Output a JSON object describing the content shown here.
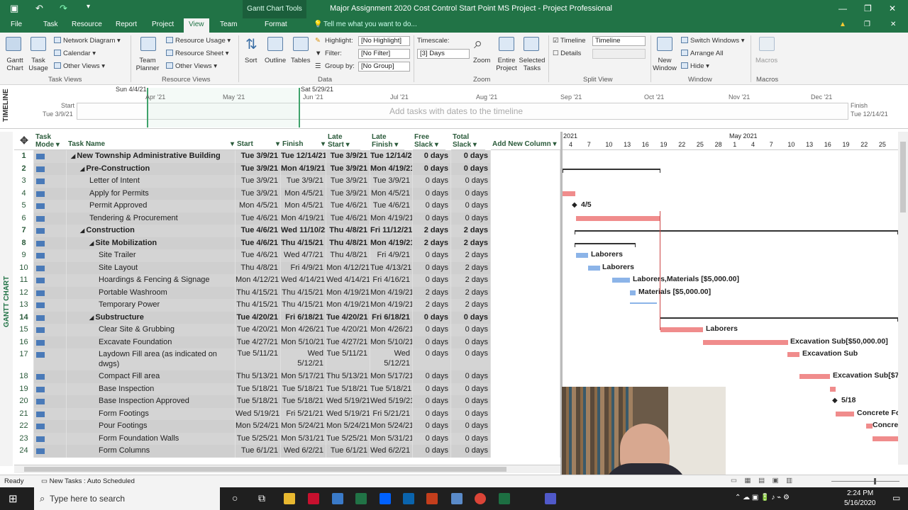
{
  "window": {
    "title": "Major Assignment  2020 Cost Control Start Point MS Project  -  Project Professional",
    "context_tab": "Gantt Chart Tools",
    "tell_me": "Tell me what you want to do..."
  },
  "tabs": [
    "File",
    "Task",
    "Resource",
    "Report",
    "Project",
    "View",
    "Team",
    "Format"
  ],
  "ribbon": {
    "gantt_chart": "Gantt Chart",
    "task_usage": "Task Usage",
    "network_diagram": "Network Diagram",
    "calendar": "Calendar",
    "other_views": "Other Views",
    "team_planner": "Team Planner",
    "resource_usage": "Resource Usage",
    "resource_sheet": "Resource Sheet",
    "other_views2": "Other Views",
    "sort": "Sort",
    "outline": "Outline",
    "tables": "Tables",
    "highlight_label": "Highlight:",
    "highlight_value": "[No Highlight]",
    "filter_label": "Filter:",
    "filter_value": "[No Filter]",
    "group_label": "Group by:",
    "group_value": "[No Group]",
    "timescale_label": "Timescale:",
    "timescale_value": "[3] Days",
    "zoom": "Zoom",
    "entire_project": "Entire Project",
    "selected_tasks": "Selected Tasks",
    "timeline_chk": "Timeline",
    "timeline_value": "Timeline",
    "details_chk": "Details",
    "new_window": "New Window",
    "switch_windows": "Switch Windows",
    "arrange_all": "Arrange All",
    "hide": "Hide",
    "macros": "Macros",
    "groups": [
      "Task Views",
      "Resource Views",
      "Data",
      "Zoom",
      "Split View",
      "Window",
      "Macros"
    ]
  },
  "timeline": {
    "side_label": "TIMELINE",
    "start_label": "Start",
    "start_date": "Tue 3/9/21",
    "finish_label": "Finish",
    "finish_date": "Tue 12/14/21",
    "marker_left": "Sun 4/4/21",
    "marker_right": "Sat 5/29/21",
    "months": [
      "Apr '21",
      "May '21",
      "Jun '21",
      "Jul '21",
      "Aug '21",
      "Sep '21",
      "Oct '21",
      "Nov '21",
      "Dec '21"
    ],
    "placeholder": "Add tasks with dates to the timeline"
  },
  "gantt_side_label": "GANTT CHART",
  "columns": [
    "Task Mode",
    "Task Name",
    "Start",
    "Finish",
    "Late Start",
    "Late Finish",
    "Free Slack",
    "Total Slack",
    "Add New Column"
  ],
  "rows": [
    {
      "id": "1",
      "name": "New Township Administrative Building",
      "start": "Tue 3/9/21",
      "finish": "Tue 12/14/21",
      "lstart": "Tue 3/9/21",
      "lfinish": "Tue 12/14/21",
      "free": "0 days",
      "total": "0 days",
      "level": 0,
      "summary": true
    },
    {
      "id": "2",
      "name": "Pre-Construction",
      "start": "Tue 3/9/21",
      "finish": "Mon 4/19/21",
      "lstart": "Tue 3/9/21",
      "lfinish": "Mon 4/19/21",
      "free": "0 days",
      "total": "0 days",
      "level": 1,
      "summary": true
    },
    {
      "id": "3",
      "name": "Letter of Intent",
      "start": "Tue 3/9/21",
      "finish": "Tue 3/9/21",
      "lstart": "Tue 3/9/21",
      "lfinish": "Tue 3/9/21",
      "free": "0 days",
      "total": "0 days",
      "level": 2,
      "summary": false
    },
    {
      "id": "4",
      "name": "Apply for Permits",
      "start": "Tue 3/9/21",
      "finish": "Mon 4/5/21",
      "lstart": "Tue 3/9/21",
      "lfinish": "Mon 4/5/21",
      "free": "0 days",
      "total": "0 days",
      "level": 2,
      "summary": false
    },
    {
      "id": "5",
      "name": "Permit Approved",
      "start": "Mon 4/5/21",
      "finish": "Mon 4/5/21",
      "lstart": "Tue 4/6/21",
      "lfinish": "Tue 4/6/21",
      "free": "0 days",
      "total": "0 days",
      "level": 2,
      "summary": false
    },
    {
      "id": "6",
      "name": "Tendering & Procurement",
      "start": "Tue 4/6/21",
      "finish": "Mon 4/19/21",
      "lstart": "Tue 4/6/21",
      "lfinish": "Mon 4/19/21",
      "free": "0 days",
      "total": "0 days",
      "level": 2,
      "summary": false
    },
    {
      "id": "7",
      "name": "Construction",
      "start": "Tue 4/6/21",
      "finish": "Wed 11/10/21",
      "lstart": "Thu 4/8/21",
      "lfinish": "Fri 11/12/21",
      "free": "2 days",
      "total": "2 days",
      "level": 1,
      "summary": true
    },
    {
      "id": "8",
      "name": "Site Mobilization",
      "start": "Tue 4/6/21",
      "finish": "Thu 4/15/21",
      "lstart": "Thu 4/8/21",
      "lfinish": "Mon 4/19/21",
      "free": "2 days",
      "total": "2 days",
      "level": 2,
      "summary": true
    },
    {
      "id": "9",
      "name": "Site Trailer",
      "start": "Tue 4/6/21",
      "finish": "Wed 4/7/21",
      "lstart": "Thu 4/8/21",
      "lfinish": "Fri 4/9/21",
      "free": "0 days",
      "total": "2 days",
      "level": 3,
      "summary": false
    },
    {
      "id": "10",
      "name": "Site Layout",
      "start": "Thu 4/8/21",
      "finish": "Fri 4/9/21",
      "lstart": "Mon 4/12/21",
      "lfinish": "Tue 4/13/21",
      "free": "0 days",
      "total": "2 days",
      "level": 3,
      "summary": false
    },
    {
      "id": "11",
      "name": "Hoardings & Fencing & Signage",
      "start": "Mon 4/12/21",
      "finish": "Wed 4/14/21",
      "lstart": "Wed 4/14/21",
      "lfinish": "Fri 4/16/21",
      "free": "0 days",
      "total": "2 days",
      "level": 3,
      "summary": false
    },
    {
      "id": "12",
      "name": "Portable Washroom",
      "start": "Thu 4/15/21",
      "finish": "Thu 4/15/21",
      "lstart": "Mon 4/19/21",
      "lfinish": "Mon 4/19/21",
      "free": "2 days",
      "total": "2 days",
      "level": 3,
      "summary": false
    },
    {
      "id": "13",
      "name": "Temporary Power",
      "start": "Thu 4/15/21",
      "finish": "Thu 4/15/21",
      "lstart": "Mon 4/19/21",
      "lfinish": "Mon 4/19/21",
      "free": "2 days",
      "total": "2 days",
      "level": 3,
      "summary": false
    },
    {
      "id": "14",
      "name": "Substructure",
      "start": "Tue 4/20/21",
      "finish": "Fri 6/18/21",
      "lstart": "Tue 4/20/21",
      "lfinish": "Fri 6/18/21",
      "free": "0 days",
      "total": "0 days",
      "level": 2,
      "summary": true
    },
    {
      "id": "15",
      "name": "Clear Site & Grubbing",
      "start": "Tue 4/20/21",
      "finish": "Mon 4/26/21",
      "lstart": "Tue 4/20/21",
      "lfinish": "Mon 4/26/21",
      "free": "0 days",
      "total": "0 days",
      "level": 3,
      "summary": false
    },
    {
      "id": "16",
      "name": "Excavate Foundation",
      "start": "Tue 4/27/21",
      "finish": "Mon 5/10/21",
      "lstart": "Tue 4/27/21",
      "lfinish": "Mon 5/10/21",
      "free": "0 days",
      "total": "0 days",
      "level": 3,
      "summary": false
    },
    {
      "id": "17",
      "name": "Laydown Fill area (as indicated on dwgs)",
      "start": "Tue 5/11/21",
      "finish": "Wed 5/12/21",
      "lstart": "Tue 5/11/21",
      "lfinish": "Wed 5/12/21",
      "free": "0 days",
      "total": "0 days",
      "level": 3,
      "summary": false,
      "tall": true
    },
    {
      "id": "18",
      "name": "Compact Fill area",
      "start": "Thu 5/13/21",
      "finish": "Mon 5/17/21",
      "lstart": "Thu 5/13/21",
      "lfinish": "Mon 5/17/21",
      "free": "0 days",
      "total": "0 days",
      "level": 3,
      "summary": false
    },
    {
      "id": "19",
      "name": "Base Inspection",
      "start": "Tue 5/18/21",
      "finish": "Tue 5/18/21",
      "lstart": "Tue 5/18/21",
      "lfinish": "Tue 5/18/21",
      "free": "0 days",
      "total": "0 days",
      "level": 3,
      "summary": false
    },
    {
      "id": "20",
      "name": "Base Inspection Approved",
      "start": "Tue 5/18/21",
      "finish": "Tue 5/18/21",
      "lstart": "Wed 5/19/21",
      "lfinish": "Wed 5/19/21",
      "free": "0 days",
      "total": "0 days",
      "level": 3,
      "summary": false
    },
    {
      "id": "21",
      "name": "Form Footings",
      "start": "Wed 5/19/21",
      "finish": "Fri 5/21/21",
      "lstart": "Wed 5/19/21",
      "lfinish": "Fri 5/21/21",
      "free": "0 days",
      "total": "0 days",
      "level": 3,
      "summary": false
    },
    {
      "id": "22",
      "name": "Pour Footings",
      "start": "Mon 5/24/21",
      "finish": "Mon 5/24/21",
      "lstart": "Mon 5/24/21",
      "lfinish": "Mon 5/24/21",
      "free": "0 days",
      "total": "0 days",
      "level": 3,
      "summary": false
    },
    {
      "id": "23",
      "name": "Form Foundation Walls",
      "start": "Tue 5/25/21",
      "finish": "Mon 5/31/21",
      "lstart": "Tue 5/25/21",
      "lfinish": "Mon 5/31/21",
      "free": "0 days",
      "total": "0 days",
      "level": 3,
      "summary": false
    },
    {
      "id": "24",
      "name": "Form Columns",
      "start": "Tue 6/1/21",
      "finish": "Wed 6/2/21",
      "lstart": "Tue 6/1/21",
      "lfinish": "Wed 6/2/21",
      "free": "0 days",
      "total": "0 days",
      "level": 3,
      "summary": false
    }
  ],
  "gantt_header": {
    "year": "2021",
    "month": "May 2021",
    "days": [
      "4",
      "7",
      "10",
      "13",
      "16",
      "19",
      "22",
      "25",
      "28",
      "1",
      "4",
      "7",
      "10",
      "13",
      "16",
      "19",
      "22",
      "25"
    ]
  },
  "bar_labels": {
    "m5": "4/5",
    "r9": "Laborers",
    "r10": "Laborers",
    "r11": "Laborers,Materials [$5,000.00]",
    "r12": "Materials [$5,000.00]",
    "r15": "Laborers",
    "r16": "Excavation Sub[$50,000.00]",
    "r17": "Excavation Sub",
    "r18": "Excavation Sub[$7,",
    "m20": "5/18",
    "r21": "Concrete Fo",
    "r22": "Concre"
  },
  "status": {
    "ready": "Ready",
    "new_tasks": "New Tasks : Auto Scheduled"
  },
  "taskbar": {
    "search": "Type here to search",
    "time": "2:24 PM",
    "date": "5/16/2020"
  }
}
